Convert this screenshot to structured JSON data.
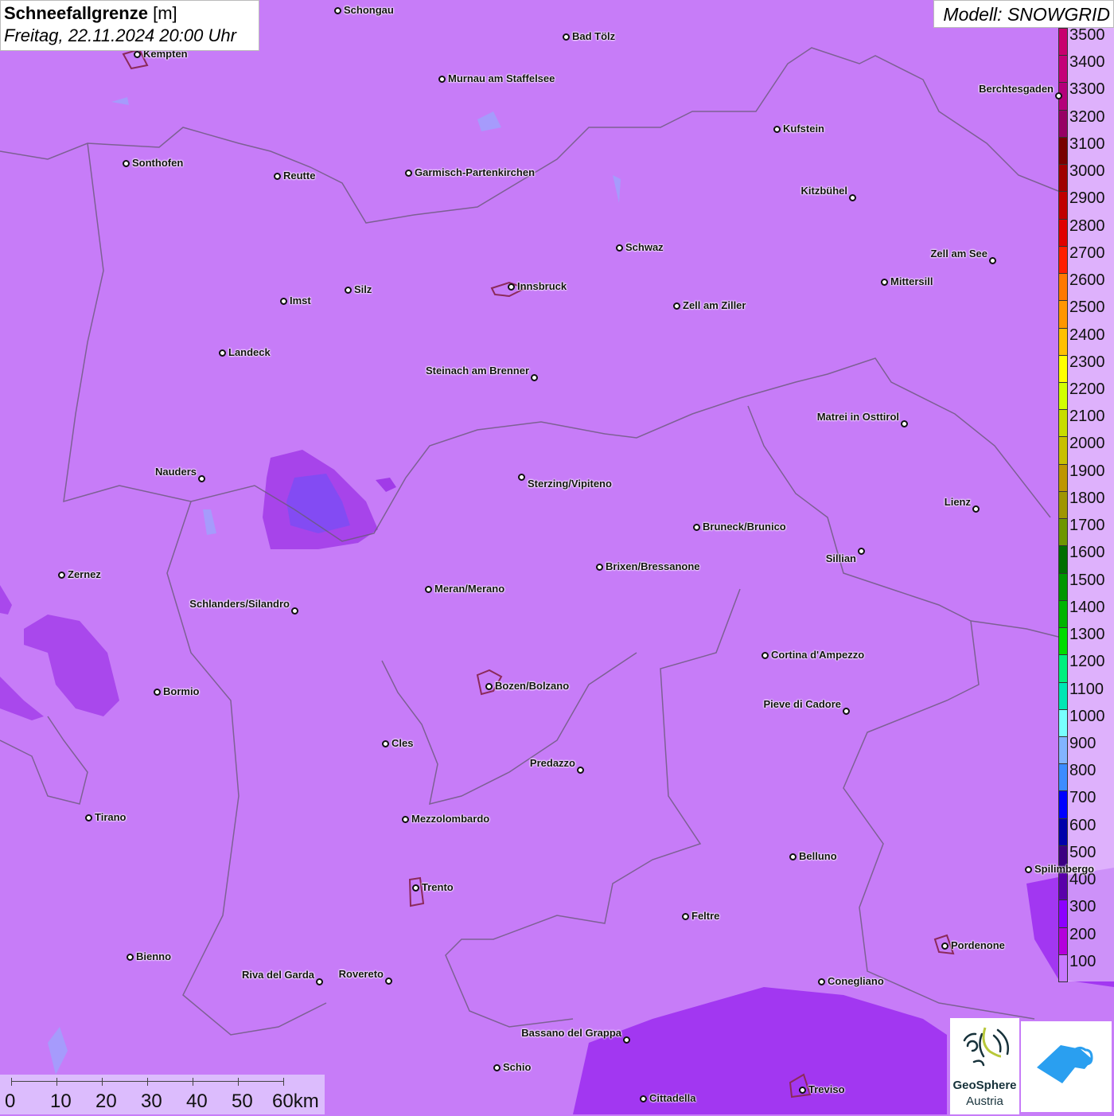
{
  "header": {
    "title_bold": "Schneefallgrenze",
    "title_unit": "[m]",
    "subtitle": "Freitag, 22.11.2024 20:00 Uhr",
    "model": "Modell: SNOWGRID"
  },
  "legend": {
    "unit": "m",
    "items": [
      {
        "label": "3500",
        "color": "#c8006e"
      },
      {
        "label": "3400",
        "color": "#c40078"
      },
      {
        "label": "3300",
        "color": "#b4007a"
      },
      {
        "label": "3200",
        "color": "#960064"
      },
      {
        "label": "3100",
        "color": "#780000"
      },
      {
        "label": "3000",
        "color": "#a00000"
      },
      {
        "label": "2900",
        "color": "#c00000"
      },
      {
        "label": "2800",
        "color": "#e00000"
      },
      {
        "label": "2700",
        "color": "#ff1e00"
      },
      {
        "label": "2600",
        "color": "#ff7800"
      },
      {
        "label": "2500",
        "color": "#ff9600"
      },
      {
        "label": "2400",
        "color": "#ffc000"
      },
      {
        "label": "2300",
        "color": "#ffff00"
      },
      {
        "label": "2200",
        "color": "#d2ff00"
      },
      {
        "label": "2100",
        "color": "#c8dc00"
      },
      {
        "label": "2000",
        "color": "#c8c000"
      },
      {
        "label": "1900",
        "color": "#be9600"
      },
      {
        "label": "1800",
        "color": "#a09600"
      },
      {
        "label": "1700",
        "color": "#6e9600"
      },
      {
        "label": "1600",
        "color": "#006e00"
      },
      {
        "label": "1500",
        "color": "#009600"
      },
      {
        "label": "1400",
        "color": "#00b400"
      },
      {
        "label": "1300",
        "color": "#00dc00"
      },
      {
        "label": "1200",
        "color": "#00f07e"
      },
      {
        "label": "1100",
        "color": "#00e6b4"
      },
      {
        "label": "1000",
        "color": "#78ffff"
      },
      {
        "label": "900",
        "color": "#82b4ff"
      },
      {
        "label": "800",
        "color": "#3c8cff"
      },
      {
        "label": "700",
        "color": "#0000ff"
      },
      {
        "label": "600",
        "color": "#0000aa"
      },
      {
        "label": "500",
        "color": "#3c0082"
      },
      {
        "label": "400",
        "color": "#5a00aa"
      },
      {
        "label": "300",
        "color": "#8c00ff"
      },
      {
        "label": "200",
        "color": "#b400dc"
      },
      {
        "label": "100",
        "color": "#c878ff"
      }
    ]
  },
  "cities": [
    "Schongau",
    "Bad Tölz",
    "Kempten",
    "Murnau am Staffelsee",
    "Berchtesgaden",
    "Kufstein",
    "Sonthofen",
    "Reutte",
    "Garmisch-Partenkirchen",
    "Kitzbühel",
    "Schwaz",
    "Zell am See",
    "Innsbruck",
    "Mittersill",
    "Silz",
    "Imst",
    "Zell am Ziller",
    "Landeck",
    "Steinach am Brenner",
    "Matrei in Osttirol",
    "Nauders",
    "Sterzing/Vipiteno",
    "Lienz",
    "Bruneck/Brunico",
    "Sillian",
    "Brixen/Bressanone",
    "Zernez",
    "Meran/Merano",
    "Schlanders/Silandro",
    "Cortina d'Ampezzo",
    "Bozen/Bolzano",
    "Bormio",
    "Pieve di Cadore",
    "Cles",
    "Predazzo",
    "Tirano",
    "Mezzolombardo",
    "Belluno",
    "Spilimbergo",
    "Trento",
    "Feltre",
    "Pordenone",
    "Bienno",
    "Riva del Garda",
    "Rovereto",
    "Conegliano",
    "Bassano del Grappa",
    "Schio",
    "Treviso",
    "Cittadella"
  ],
  "scale": {
    "labels": [
      "0",
      "10",
      "20",
      "30",
      "40",
      "50",
      "60km"
    ]
  },
  "logos": {
    "geosphere_line1": "GeoSphere",
    "geosphere_line2": "Austria"
  },
  "colors": {
    "background": "#c77cf8",
    "low": "#9b2bf0"
  }
}
